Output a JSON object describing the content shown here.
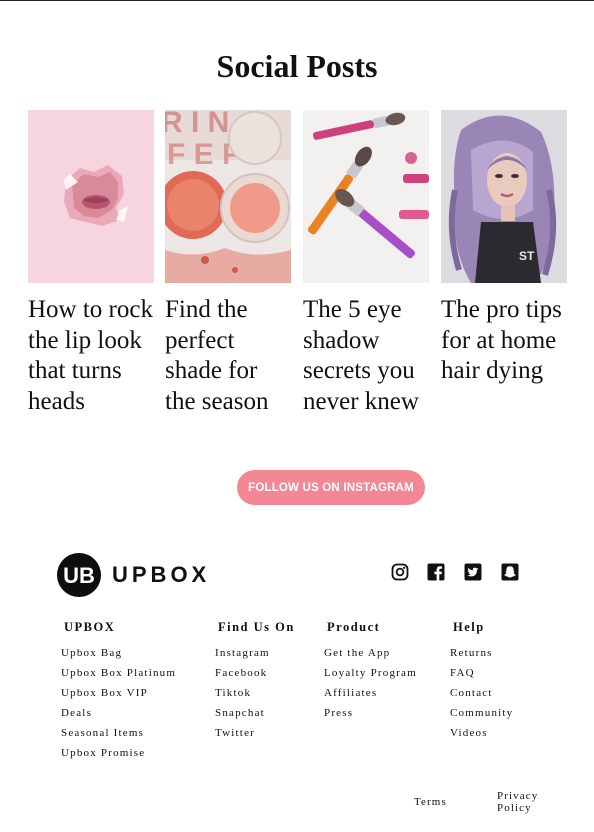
{
  "section": {
    "title": "Social Posts"
  },
  "posts": [
    {
      "caption": "How to rock the lip look that turns heads"
    },
    {
      "caption": "Find the perfect shade for the season"
    },
    {
      "caption": "The 5 eye shadow secrets you never knew"
    },
    {
      "caption": "The pro tips for at home hair dying"
    }
  ],
  "cta": {
    "label": "FOLLOW US ON INSTAGRAM",
    "color": "#f38796"
  },
  "brand": {
    "logo_text": "UB",
    "name": "UPBOX"
  },
  "social_icons": [
    "instagram-icon",
    "facebook-icon",
    "twitter-icon",
    "snapchat-icon"
  ],
  "footer": {
    "columns": [
      {
        "heading": "UPBOX",
        "links": [
          "Upbox Bag",
          "Upbox Box Platinum",
          "Upbox Box VIP",
          "Deals",
          "Seasonal Items",
          "Upbox Promise"
        ]
      },
      {
        "heading": "Find Us On",
        "links": [
          "Instagram",
          "Facebook",
          "Tiktok",
          "Snapchat",
          "Twitter"
        ]
      },
      {
        "heading": "Product",
        "links": [
          "Get the App",
          "Loyalty Program",
          "Affiliates",
          "Press"
        ]
      },
      {
        "heading": "Help",
        "links": [
          "Returns",
          "FAQ",
          "Contact",
          "Community",
          "Videos"
        ]
      }
    ],
    "legal": {
      "terms": "Terms",
      "privacy_line1": "Privacy",
      "privacy_line2": "Policy"
    }
  }
}
